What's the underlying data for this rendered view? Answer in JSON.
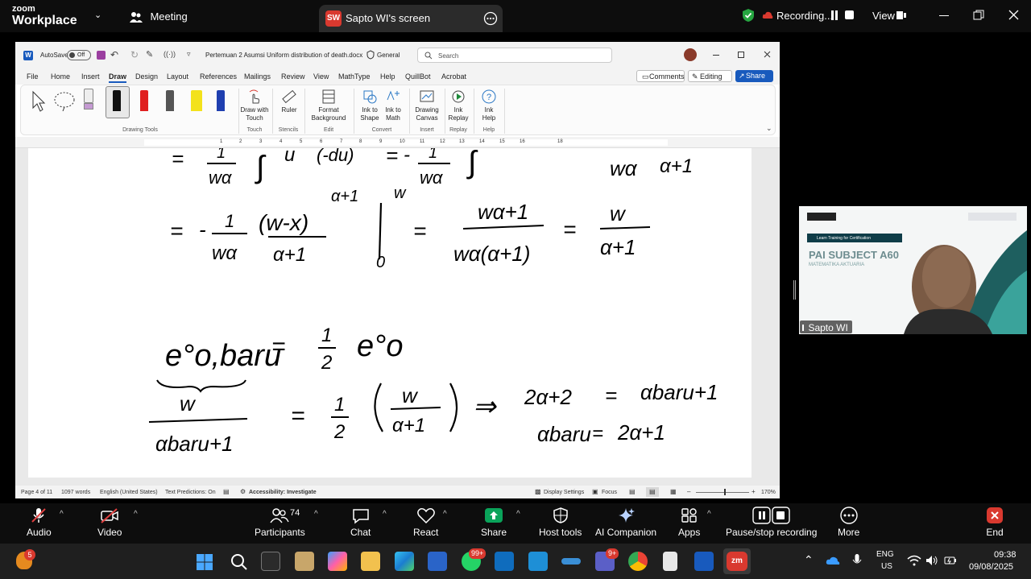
{
  "zoom": {
    "brand_top": "zoom",
    "brand_bottom": "Workplace",
    "meeting_label": "Meeting",
    "share_tab": {
      "badge": "SW",
      "title": "Sapto WI's screen"
    },
    "recording_label": "Recording...",
    "view_label": "View",
    "bottom_bar": {
      "audio": "Audio",
      "video": "Video",
      "participants": "Participants",
      "participants_count": "74",
      "chat": "Chat",
      "react": "React",
      "share": "Share",
      "host_tools": "Host tools",
      "ai_companion": "AI Companion",
      "apps": "Apps",
      "pause_stop": "Pause/stop recording",
      "more": "More",
      "end": "End"
    },
    "participant_video": {
      "name": "Sapto WI",
      "slide_title": "PAI SUBJECT A60",
      "slide_subtitle": "MATEMATIKA AKTUARIA",
      "slide_tagline": "Learn Training for Certification"
    }
  },
  "word": {
    "autosave": "AutoSave",
    "autosave_state": "Off",
    "filename": "Pertemuan 2 Asumsi Uniform distribution of death.docx",
    "sensitivity": "General",
    "search_placeholder": "Search",
    "menu": [
      "File",
      "Home",
      "Insert",
      "Draw",
      "Design",
      "Layout",
      "References",
      "Mailings",
      "Review",
      "View",
      "MathType",
      "Help",
      "QuillBot",
      "Acrobat"
    ],
    "comments": "Comments",
    "editing": "Editing",
    "share": "Share",
    "ribbon": {
      "draw_with_touch": [
        "Draw with",
        "Touch"
      ],
      "ruler": "Ruler",
      "format_background": [
        "Format",
        "Background"
      ],
      "ink_to_shape": [
        "Ink to",
        "Shape"
      ],
      "ink_to_math": [
        "Ink to",
        "Math"
      ],
      "drawing_canvas": [
        "Drawing",
        "Canvas"
      ],
      "ink_replay": [
        "Ink",
        "Replay"
      ],
      "ink_help": [
        "Ink",
        "Help"
      ],
      "groups": [
        "Drawing Tools",
        "Touch",
        "Stencils",
        "Edit",
        "Convert",
        "Insert",
        "Replay",
        "Help"
      ]
    },
    "ruler_numbers": [
      "1",
      "2",
      "3",
      "4",
      "5",
      "6",
      "7",
      "8",
      "9",
      "10",
      "11",
      "12",
      "13",
      "14",
      "15",
      "16",
      "18"
    ],
    "status": {
      "page": "Page 4 of 11",
      "words": "1097 words",
      "language": "English (United States)",
      "predictions": "Text Predictions: On",
      "accessibility": "Accessibility: Investigate",
      "display_settings": "Display Settings",
      "focus": "Focus",
      "zoom": "170%"
    },
    "ink": {
      "line1": [
        "=",
        "1",
        "wα",
        "∫",
        "u",
        "(-du)",
        "=",
        "-",
        "1",
        "wα",
        "∫",
        "wα",
        "α+1"
      ],
      "line2": [
        "=",
        "-",
        "1",
        "wα",
        "(w-x)",
        "α+1",
        "α+1",
        "w",
        "0",
        "=",
        "wα+1",
        "wα(α+1)",
        "=",
        "w",
        "α+1"
      ],
      "line3": [
        "e°o,baru",
        "=",
        "1",
        "2",
        "e°o"
      ],
      "line4": [
        "w",
        "αbaru+1",
        "=",
        "1",
        "2",
        "w",
        "α+1",
        "⇒",
        "2α+2",
        "=",
        "αbaru+1",
        "αbaru",
        "=",
        "2α+1"
      ]
    }
  },
  "taskbar": {
    "badge_orange": "5",
    "badge_whatsapp": "99+",
    "badge_teams": "9+",
    "lang_top": "ENG",
    "lang_bottom": "US",
    "time": "09:38",
    "date": "09/08/2025"
  },
  "colors": {
    "zoom_bg": "#0d0d0d",
    "word_blue": "#185abd",
    "rec_green": "#26a641",
    "end_red": "#d9392f",
    "share_green": "#0aa35a"
  }
}
